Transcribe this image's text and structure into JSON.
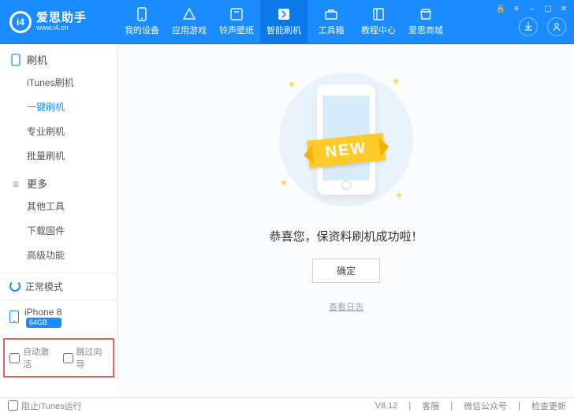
{
  "logo": {
    "brand": "爱思助手",
    "url": "www.i4.cn",
    "icon_text": "i4"
  },
  "nav": [
    {
      "label": "我的设备",
      "icon": "device"
    },
    {
      "label": "应用游戏",
      "icon": "apps"
    },
    {
      "label": "铃声壁纸",
      "icon": "music"
    },
    {
      "label": "智能刷机",
      "icon": "flash",
      "active": true
    },
    {
      "label": "工具箱",
      "icon": "toolbox"
    },
    {
      "label": "教程中心",
      "icon": "book"
    },
    {
      "label": "爱思商城",
      "icon": "store"
    }
  ],
  "sidebar": {
    "groups": [
      {
        "title": "刷机",
        "icon": "phone",
        "items": [
          "iTunes刷机",
          "一键刷机",
          "专业刷机",
          "批量刷机"
        ],
        "active_index": 1
      },
      {
        "title": "更多",
        "icon": "more",
        "items": [
          "其他工具",
          "下载固件",
          "高级功能"
        ]
      }
    ],
    "mode": "正常模式",
    "device": {
      "name": "iPhone 8",
      "storage": "64GB"
    },
    "bottom_checks": [
      "自动激活",
      "跳过向导"
    ]
  },
  "main": {
    "ribbon": "NEW",
    "message": "恭喜您，保资料刷机成功啦！",
    "ok": "确定",
    "log": "查看日志"
  },
  "statusbar": {
    "left_check": "阻止iTunes运行",
    "version": "V8.12",
    "links": [
      "客服",
      "微信公众号",
      "检查更新"
    ]
  }
}
